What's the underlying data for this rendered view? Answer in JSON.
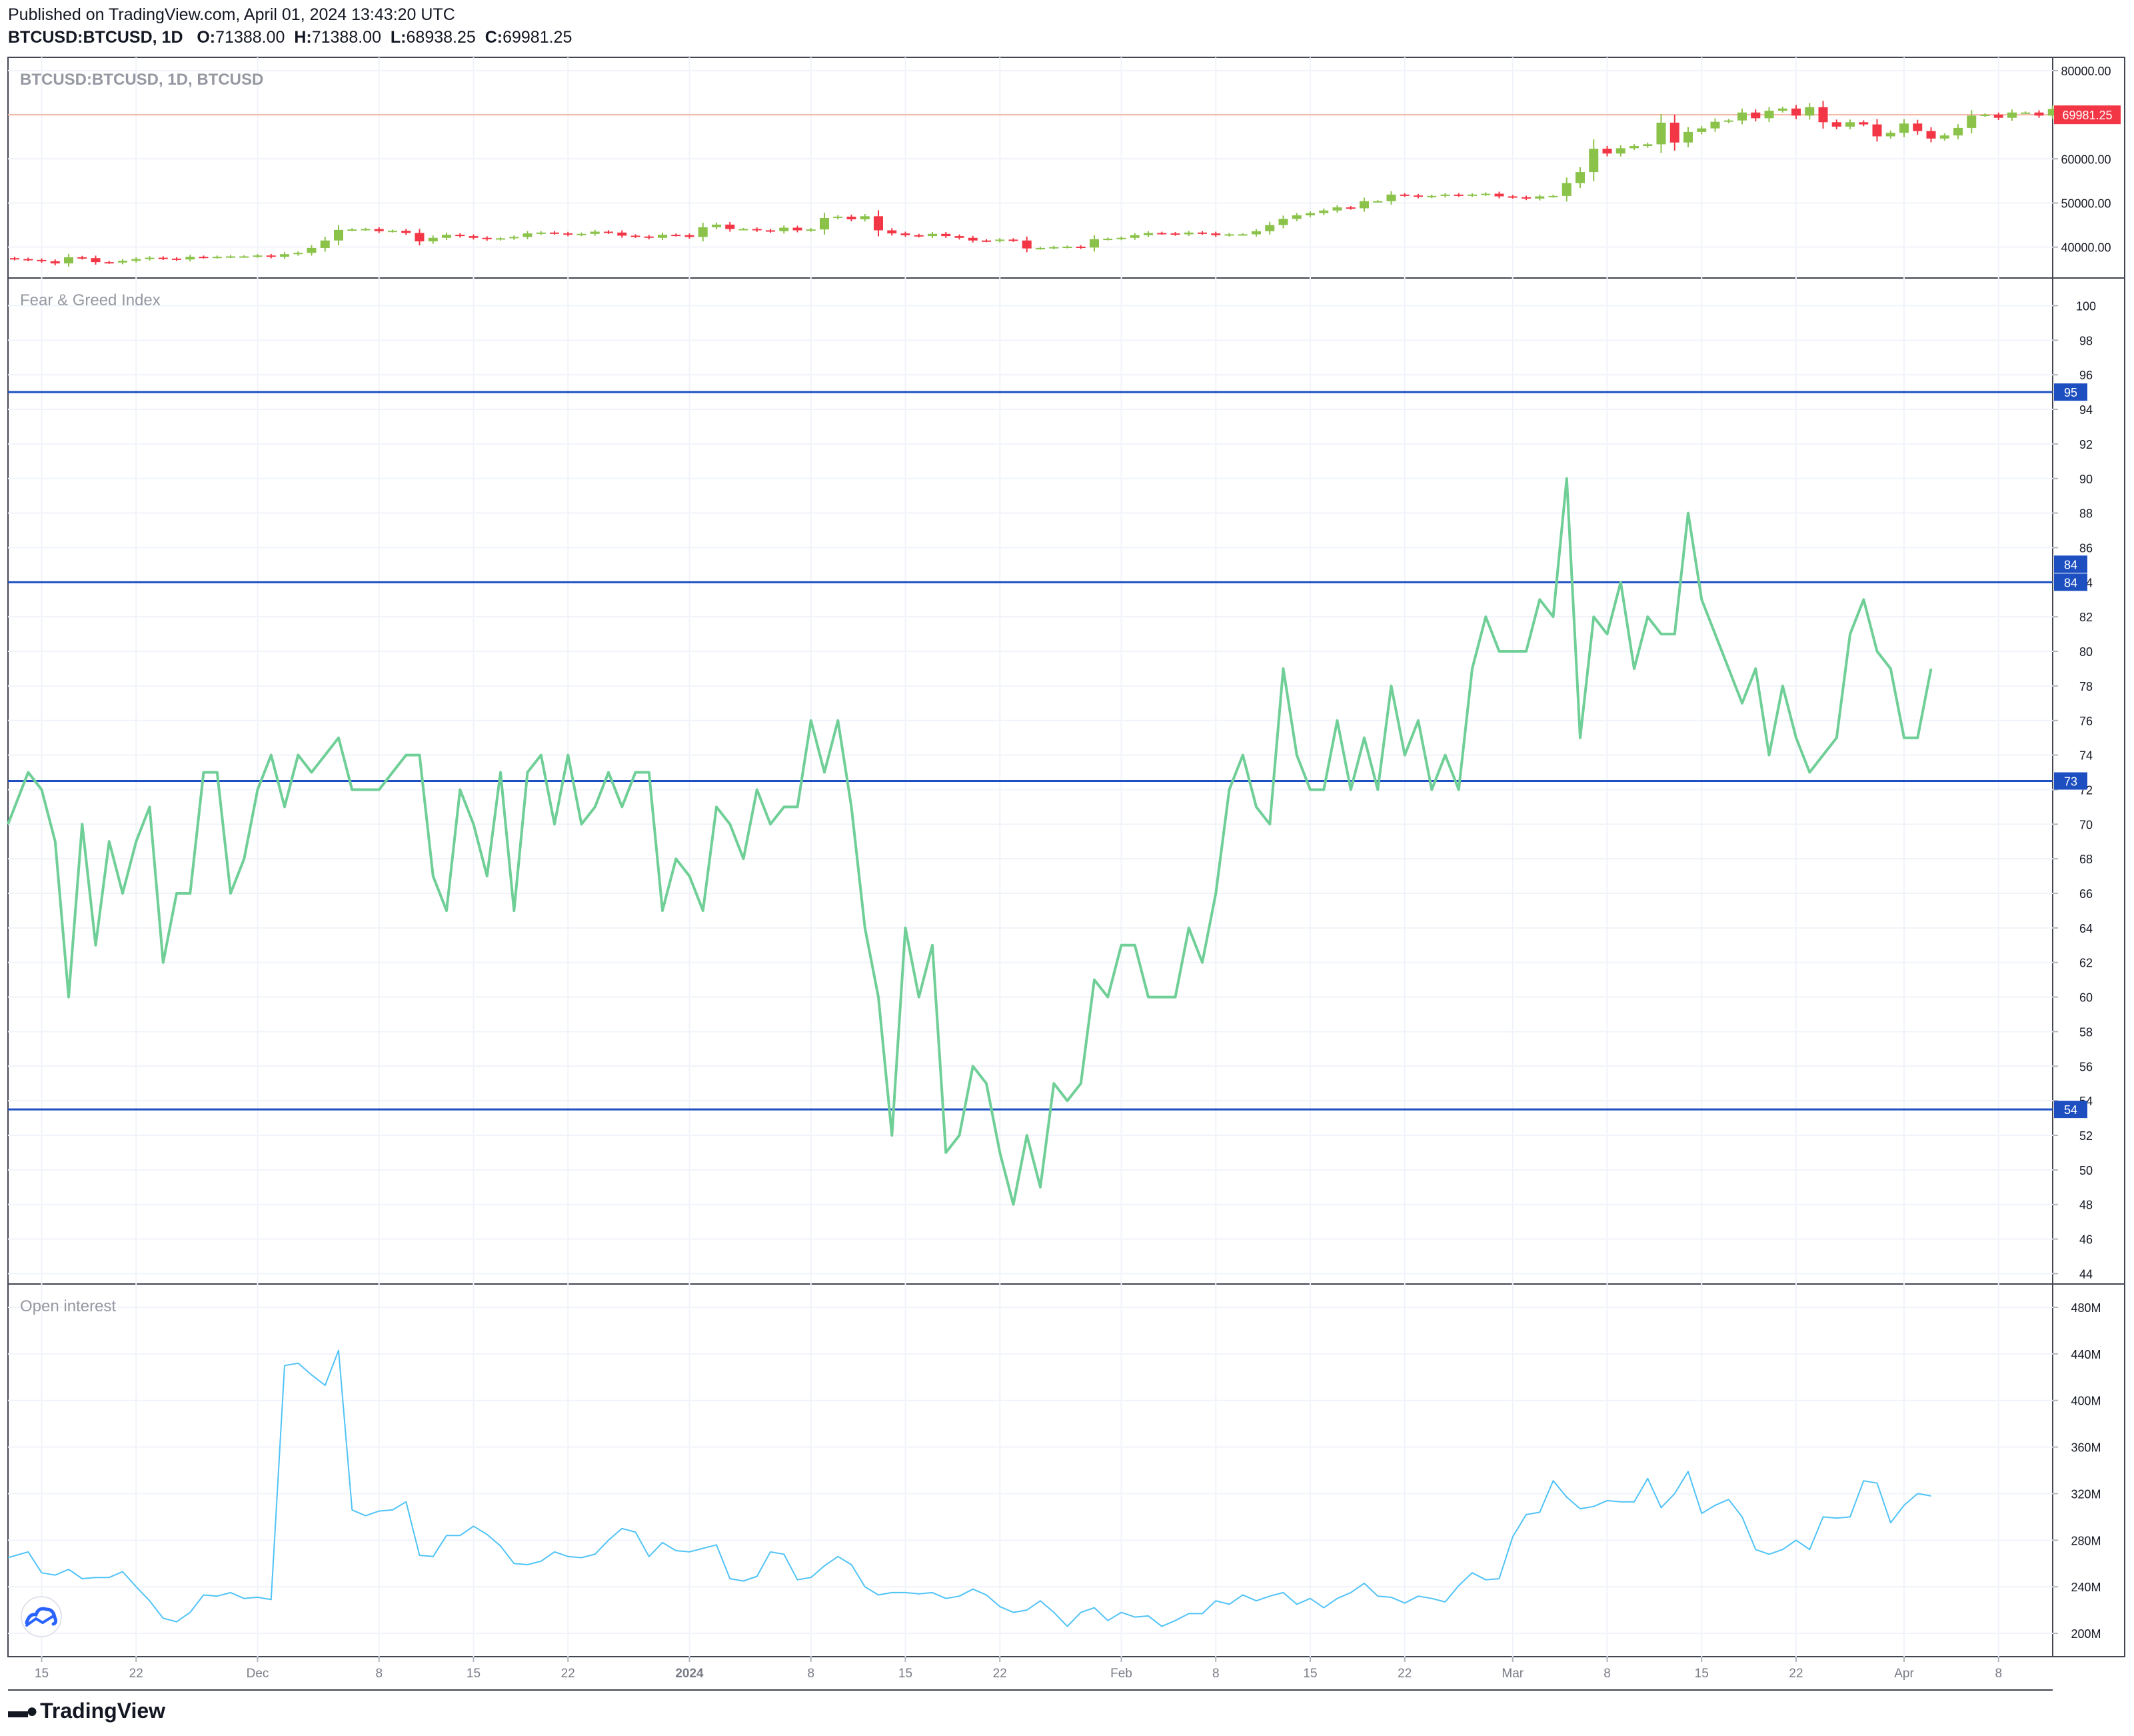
{
  "header": {
    "published": "Published on TradingView.com, April 01, 2024 13:43:20 UTC",
    "symbol": "BTCUSD:BTCUSD, 1D",
    "o_label": "O:",
    "o_value": "71388.00",
    "h_label": "H:",
    "h_value": "71388.00",
    "l_label": "L:",
    "l_value": "68938.25",
    "c_label": "C:",
    "c_value": "69981.25"
  },
  "brand": {
    "name": "TradingView",
    "logo_icon": "tradingview-logo-icon",
    "watermark_icon": "tradingview-cloud-icon"
  },
  "colors": {
    "up": "#8bc34a",
    "down": "#f23645",
    "fng_line": "#6fcf97",
    "oi_line": "#4fc3f7",
    "hline": "#1e4fc1",
    "last_price": "#f23645",
    "price_line": "#f5b5a0"
  },
  "chart_data": [
    {
      "type": "candlestick",
      "title": "BTCUSD:BTCUSD, 1D, BTCUSD",
      "ylim": [
        33000,
        83000
      ],
      "y_ticks": [
        40000,
        50000,
        60000,
        70000,
        80000
      ],
      "y_tick_labels": [
        "40000.00",
        "50000.00",
        "60000.00",
        "70000.00",
        "80000.00"
      ],
      "last_price": 69981.25,
      "last_price_label": "69981.25",
      "closes": [
        37300,
        37100,
        36800,
        36300,
        37700,
        37500,
        36600,
        36500,
        36900,
        37300,
        37600,
        37400,
        37200,
        37800,
        37700,
        37800,
        37900,
        37900,
        38100,
        37800,
        38400,
        38700,
        39800,
        41500,
        43900,
        44000,
        44100,
        43600,
        43700,
        43200,
        41300,
        42100,
        42800,
        42500,
        42100,
        41800,
        42000,
        42300,
        43100,
        43300,
        43100,
        42800,
        43000,
        43500,
        43300,
        42600,
        42400,
        42100,
        42800,
        42700,
        42300,
        44500,
        45100,
        44100,
        44100,
        43800,
        43600,
        44400,
        43800,
        44000,
        46600,
        46900,
        46300,
        47000,
        43800,
        43100,
        42700,
        42500,
        43000,
        42500,
        42100,
        41500,
        41400,
        41700,
        41500,
        39700,
        39800,
        40000,
        40100,
        39900,
        41800,
        41900,
        42100,
        42700,
        43200,
        43100,
        42900,
        43300,
        43100,
        42700,
        42900,
        42900,
        43600,
        45000,
        46400,
        47200,
        47700,
        48300,
        49000,
        48800,
        50400,
        50400,
        51900,
        51700,
        51400,
        51600,
        51900,
        51700,
        51900,
        52100,
        51500,
        51300,
        51000,
        51500,
        51600,
        54500,
        57000,
        62300,
        61200,
        62400,
        62900,
        63300,
        68200,
        63700,
        66100,
        66900,
        68400,
        68700,
        70500,
        69200,
        70900,
        71400,
        69800,
        71700,
        68300,
        67300,
        68300,
        67800,
        65100,
        65900,
        68000,
        66300,
        64600,
        65300,
        67000,
        69800,
        70000,
        69300,
        70500,
        70500,
        69800,
        71300,
        69981
      ],
      "ohlc_last": {
        "open": 71388.0,
        "high": 71388.0,
        "low": 68938.25,
        "close": 69981.25
      }
    },
    {
      "type": "line",
      "title": "Fear & Greed Index",
      "ylim": [
        43.4,
        101.6
      ],
      "y_ticks": [
        44,
        46,
        48,
        50,
        52,
        54,
        56,
        58,
        60,
        62,
        64,
        66,
        68,
        70,
        72,
        74,
        76,
        78,
        80,
        82,
        84,
        86,
        88,
        90,
        92,
        94,
        96,
        98,
        100
      ],
      "hlines": [
        {
          "value": 95,
          "label": "95"
        },
        {
          "value": 84,
          "label": "84",
          "extra_label": "84"
        },
        {
          "value": 72.5,
          "label": "73"
        },
        {
          "value": 53.5,
          "label": "54"
        }
      ],
      "values": [
        70,
        73,
        72,
        69,
        60,
        70,
        63,
        69,
        66,
        69,
        71,
        62,
        66,
        66,
        73,
        73,
        66,
        68,
        72,
        74,
        71,
        74,
        73,
        74,
        75,
        72,
        72,
        72,
        73,
        74,
        74,
        67,
        65,
        72,
        70,
        67,
        73,
        65,
        73,
        74,
        70,
        74,
        70,
        71,
        73,
        71,
        73,
        73,
        65,
        68,
        67,
        65,
        71,
        70,
        68,
        72,
        70,
        71,
        71,
        76,
        73,
        76,
        71,
        64,
        60,
        52,
        64,
        60,
        63,
        51,
        52,
        56,
        55,
        51,
        48,
        52,
        49,
        55,
        54,
        55,
        61,
        60,
        63,
        63,
        60,
        60,
        60,
        64,
        62,
        66,
        72,
        74,
        71,
        70,
        79,
        74,
        72,
        72,
        76,
        72,
        75,
        72,
        78,
        74,
        76,
        72,
        74,
        72,
        79,
        82,
        80,
        80,
        80,
        83,
        82,
        90,
        75,
        82,
        81,
        84,
        79,
        82,
        81,
        81,
        88,
        83,
        81,
        79,
        77,
        79,
        74,
        78,
        75,
        73,
        74,
        75,
        81,
        83,
        80,
        79,
        75,
        75,
        79
      ]
    },
    {
      "type": "line",
      "title": "Open interest",
      "ylim": [
        180000000,
        500000000
      ],
      "y_ticks": [
        200000000,
        240000000,
        280000000,
        320000000,
        360000000,
        400000000,
        440000000,
        480000000
      ],
      "y_tick_labels": [
        "200M",
        "240M",
        "280M",
        "320M",
        "360M",
        "400M",
        "440M",
        "480M"
      ],
      "values": [
        265,
        270,
        252,
        250,
        255,
        247,
        248,
        248,
        253,
        240,
        228,
        213,
        210,
        218,
        233,
        232,
        235,
        230,
        231,
        229,
        430,
        432,
        422,
        413,
        443,
        306,
        301,
        305,
        306,
        313,
        267,
        266,
        284,
        284,
        292,
        285,
        275,
        260,
        259,
        262,
        270,
        266,
        265,
        268,
        280,
        290,
        287,
        266,
        278,
        271,
        270,
        273,
        276,
        247,
        245,
        249,
        270,
        268,
        246,
        248,
        258,
        266,
        259,
        240,
        233,
        235,
        235,
        234,
        235,
        230,
        232,
        238,
        233,
        223,
        218,
        220,
        228,
        218,
        206,
        218,
        222,
        211,
        218,
        214,
        215,
        206,
        211,
        217,
        217,
        228,
        225,
        233,
        228,
        232,
        235,
        225,
        230,
        222,
        230,
        235,
        243,
        232,
        231,
        226,
        232,
        230,
        227,
        241,
        252,
        246,
        247,
        283,
        302,
        304,
        331,
        317,
        307,
        309,
        314,
        313,
        313,
        333,
        308,
        320,
        339,
        303,
        310,
        315,
        300,
        272,
        268,
        272,
        280,
        272,
        300,
        299,
        300,
        331,
        329,
        295,
        310,
        320,
        318
      ]
    }
  ],
  "x_axis": {
    "labels": [
      "15",
      "22",
      "Dec",
      "8",
      "15",
      "22",
      "2024",
      "8",
      "15",
      "22",
      "Feb",
      "8",
      "15",
      "22",
      "Mar",
      "8",
      "15",
      "22",
      "Apr",
      "8"
    ],
    "label_bar_index": [
      2,
      9,
      18,
      27,
      34,
      41,
      50,
      59,
      66,
      73,
      82,
      89,
      96,
      103,
      111,
      118,
      125,
      132,
      140,
      147
    ],
    "bold": [
      "2024"
    ]
  }
}
